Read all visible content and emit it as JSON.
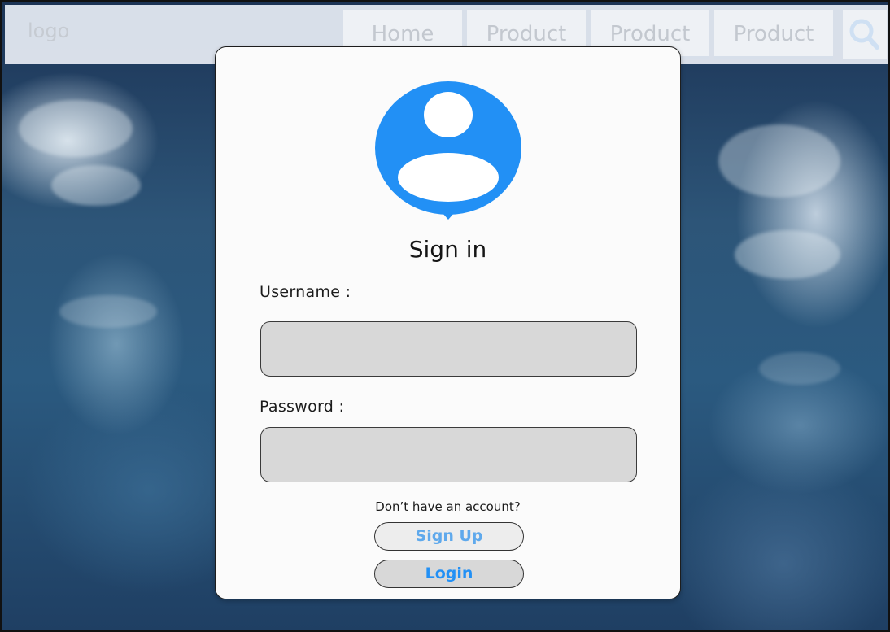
{
  "header": {
    "logo": "logo",
    "nav": [
      "Home",
      "Product",
      "Product",
      "Product"
    ],
    "search_icon": "search-icon"
  },
  "signin": {
    "avatar_icon": "user-avatar-icon",
    "title": "Sign in",
    "username_label": "Username :",
    "username_value": "",
    "password_label": "Password :",
    "password_value": "",
    "no_account_text": "Don’t have an account?",
    "signup_label": "Sign Up",
    "login_label": "Login"
  },
  "colors": {
    "accent": "#2290f5",
    "signup_text": "#5fa9ec",
    "signup_bg": "#ededed",
    "login_bg": "#d8d8d8",
    "field_bg": "#d8d8d8"
  }
}
